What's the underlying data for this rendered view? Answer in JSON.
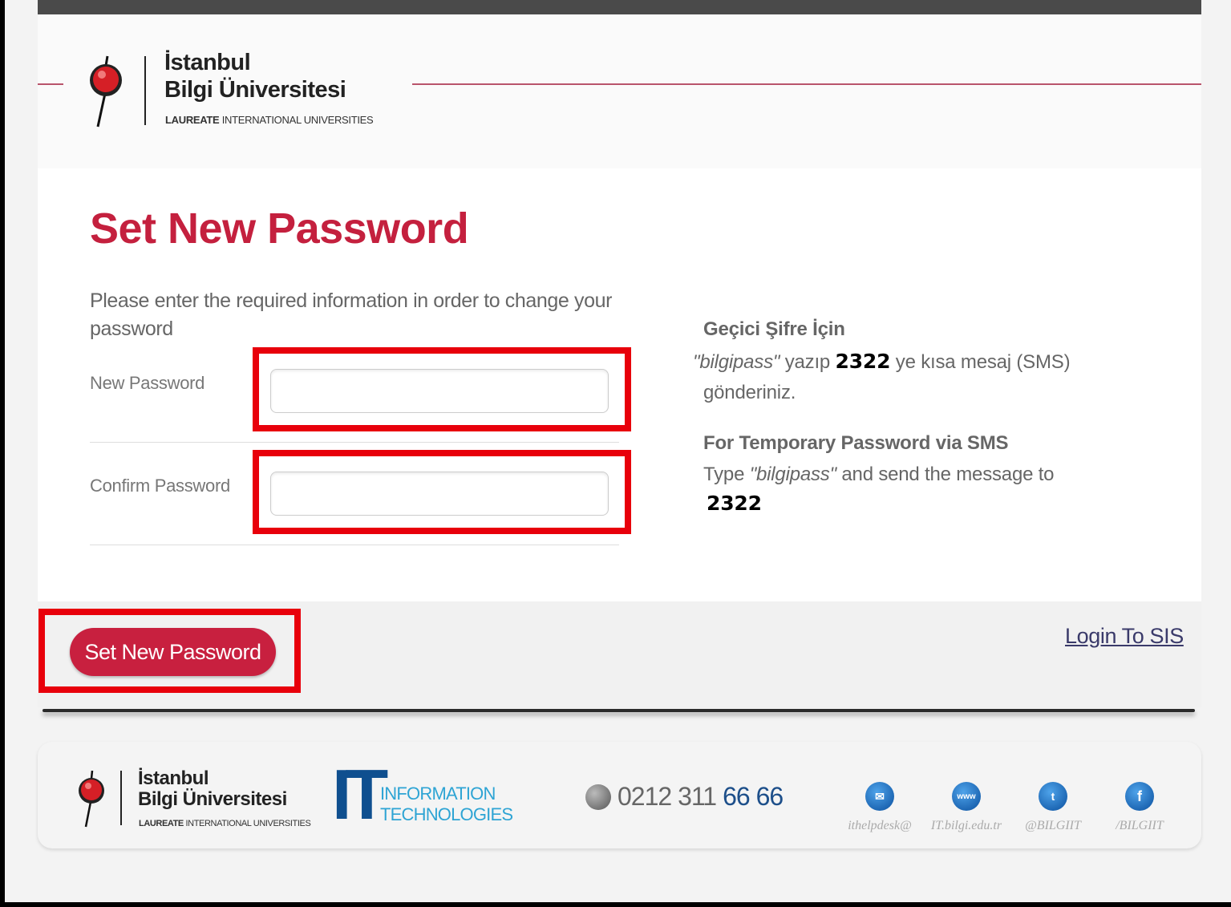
{
  "header": {
    "logo_line1": "İstanbul",
    "logo_line2": "Bilgi Üniversitesi",
    "logo_line3_bold": "LAUREATE",
    "logo_line3_rest": " INTERNATIONAL UNIVERSITIES"
  },
  "form": {
    "title": "Set New Password",
    "intro": "Please enter the required information in order to change your password",
    "new_password_label": "New Password",
    "confirm_password_label": "Confirm Password",
    "new_password_value": "",
    "confirm_password_value": ""
  },
  "sms_info": {
    "tr_heading": "Geçici Şifre İçin",
    "tr_keyword": "\"bilgipass\"",
    "tr_text1": " yazıp ",
    "tr_number": "2322",
    "tr_text2": " ye kısa mesaj (SMS)",
    "tr_text3": "gönderiniz.",
    "en_heading": "For Temporary Password via SMS",
    "en_text1": "Type ",
    "en_keyword": "\"bilgipass\"",
    "en_text2": " and send the message to",
    "en_number": "2322"
  },
  "actions": {
    "submit_label": "Set New Password",
    "login_link": "Login To SIS"
  },
  "footer": {
    "logo_line1": "İstanbul",
    "logo_line2": "Bilgi Üniversitesi",
    "logo_line3_bold": "LAUREATE",
    "logo_line3_rest": " INTERNATIONAL UNIVERSITIES",
    "it_big": "IT",
    "it_line1": "INFORMATION",
    "it_line2": "TECHNOLOGIES",
    "phone_prefix": "0212 311",
    "phone_suffix": "66 66",
    "social": [
      {
        "icon": "mail-icon",
        "caption": "ithelpdesk@"
      },
      {
        "icon": "www-icon",
        "caption": "IT.bilgi.edu.tr"
      },
      {
        "icon": "twitter-icon",
        "caption": "@BILGIIT"
      },
      {
        "icon": "facebook-icon",
        "caption": "/BILGIIT"
      }
    ]
  },
  "colors": {
    "brand_red": "#c4203e",
    "highlight_red": "#e8000b",
    "it_blue": "#0f4f8f"
  }
}
